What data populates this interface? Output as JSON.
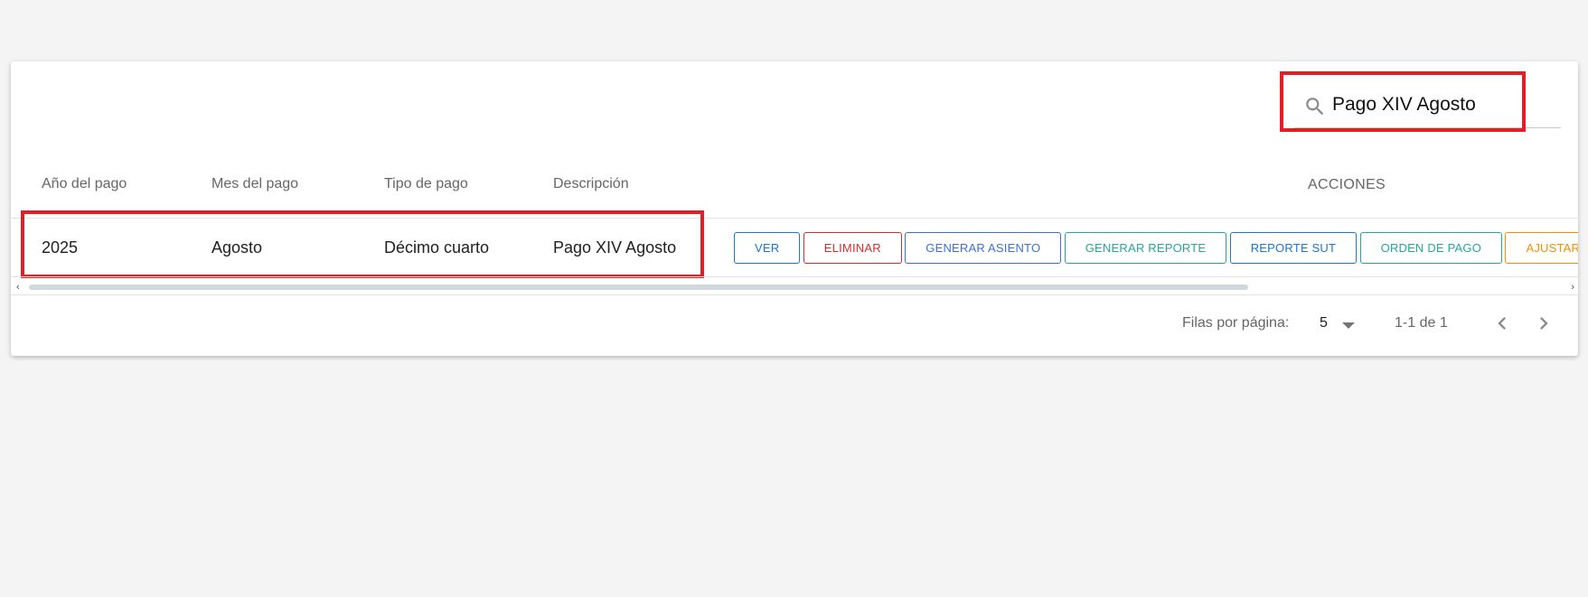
{
  "search": {
    "value": "Pago XIV Agosto"
  },
  "table": {
    "headers": {
      "year": "Año del pago",
      "month": "Mes del pago",
      "type": "Tipo de pago",
      "description": "Descripción",
      "actions": "ACCIONES"
    },
    "rows": [
      {
        "year": "2025",
        "month": "Agosto",
        "type": "Décimo cuarto",
        "description": "Pago XIV Agosto"
      }
    ],
    "actions": [
      {
        "label": "VER",
        "color": "#1976d2"
      },
      {
        "label": "ELIMINAR",
        "color": "#d32f2f"
      },
      {
        "label": "GENERAR ASIENTO",
        "color": "#3f6fd6"
      },
      {
        "label": "GENERAR REPORTE",
        "color": "#26a69a"
      },
      {
        "label": "REPORTE SUT",
        "color": "#1976d2"
      },
      {
        "label": "ORDEN DE PAGO",
        "color": "#26a69a"
      },
      {
        "label": "AJUSTAR VALOR A",
        "color": "#fb8c00"
      }
    ]
  },
  "footer": {
    "rows_per_page_label": "Filas por página:",
    "rows_per_page_value": "5",
    "range": "1-1 de 1"
  },
  "colors": {
    "highlight": "#e41e26",
    "background": "#f4f4f4"
  }
}
